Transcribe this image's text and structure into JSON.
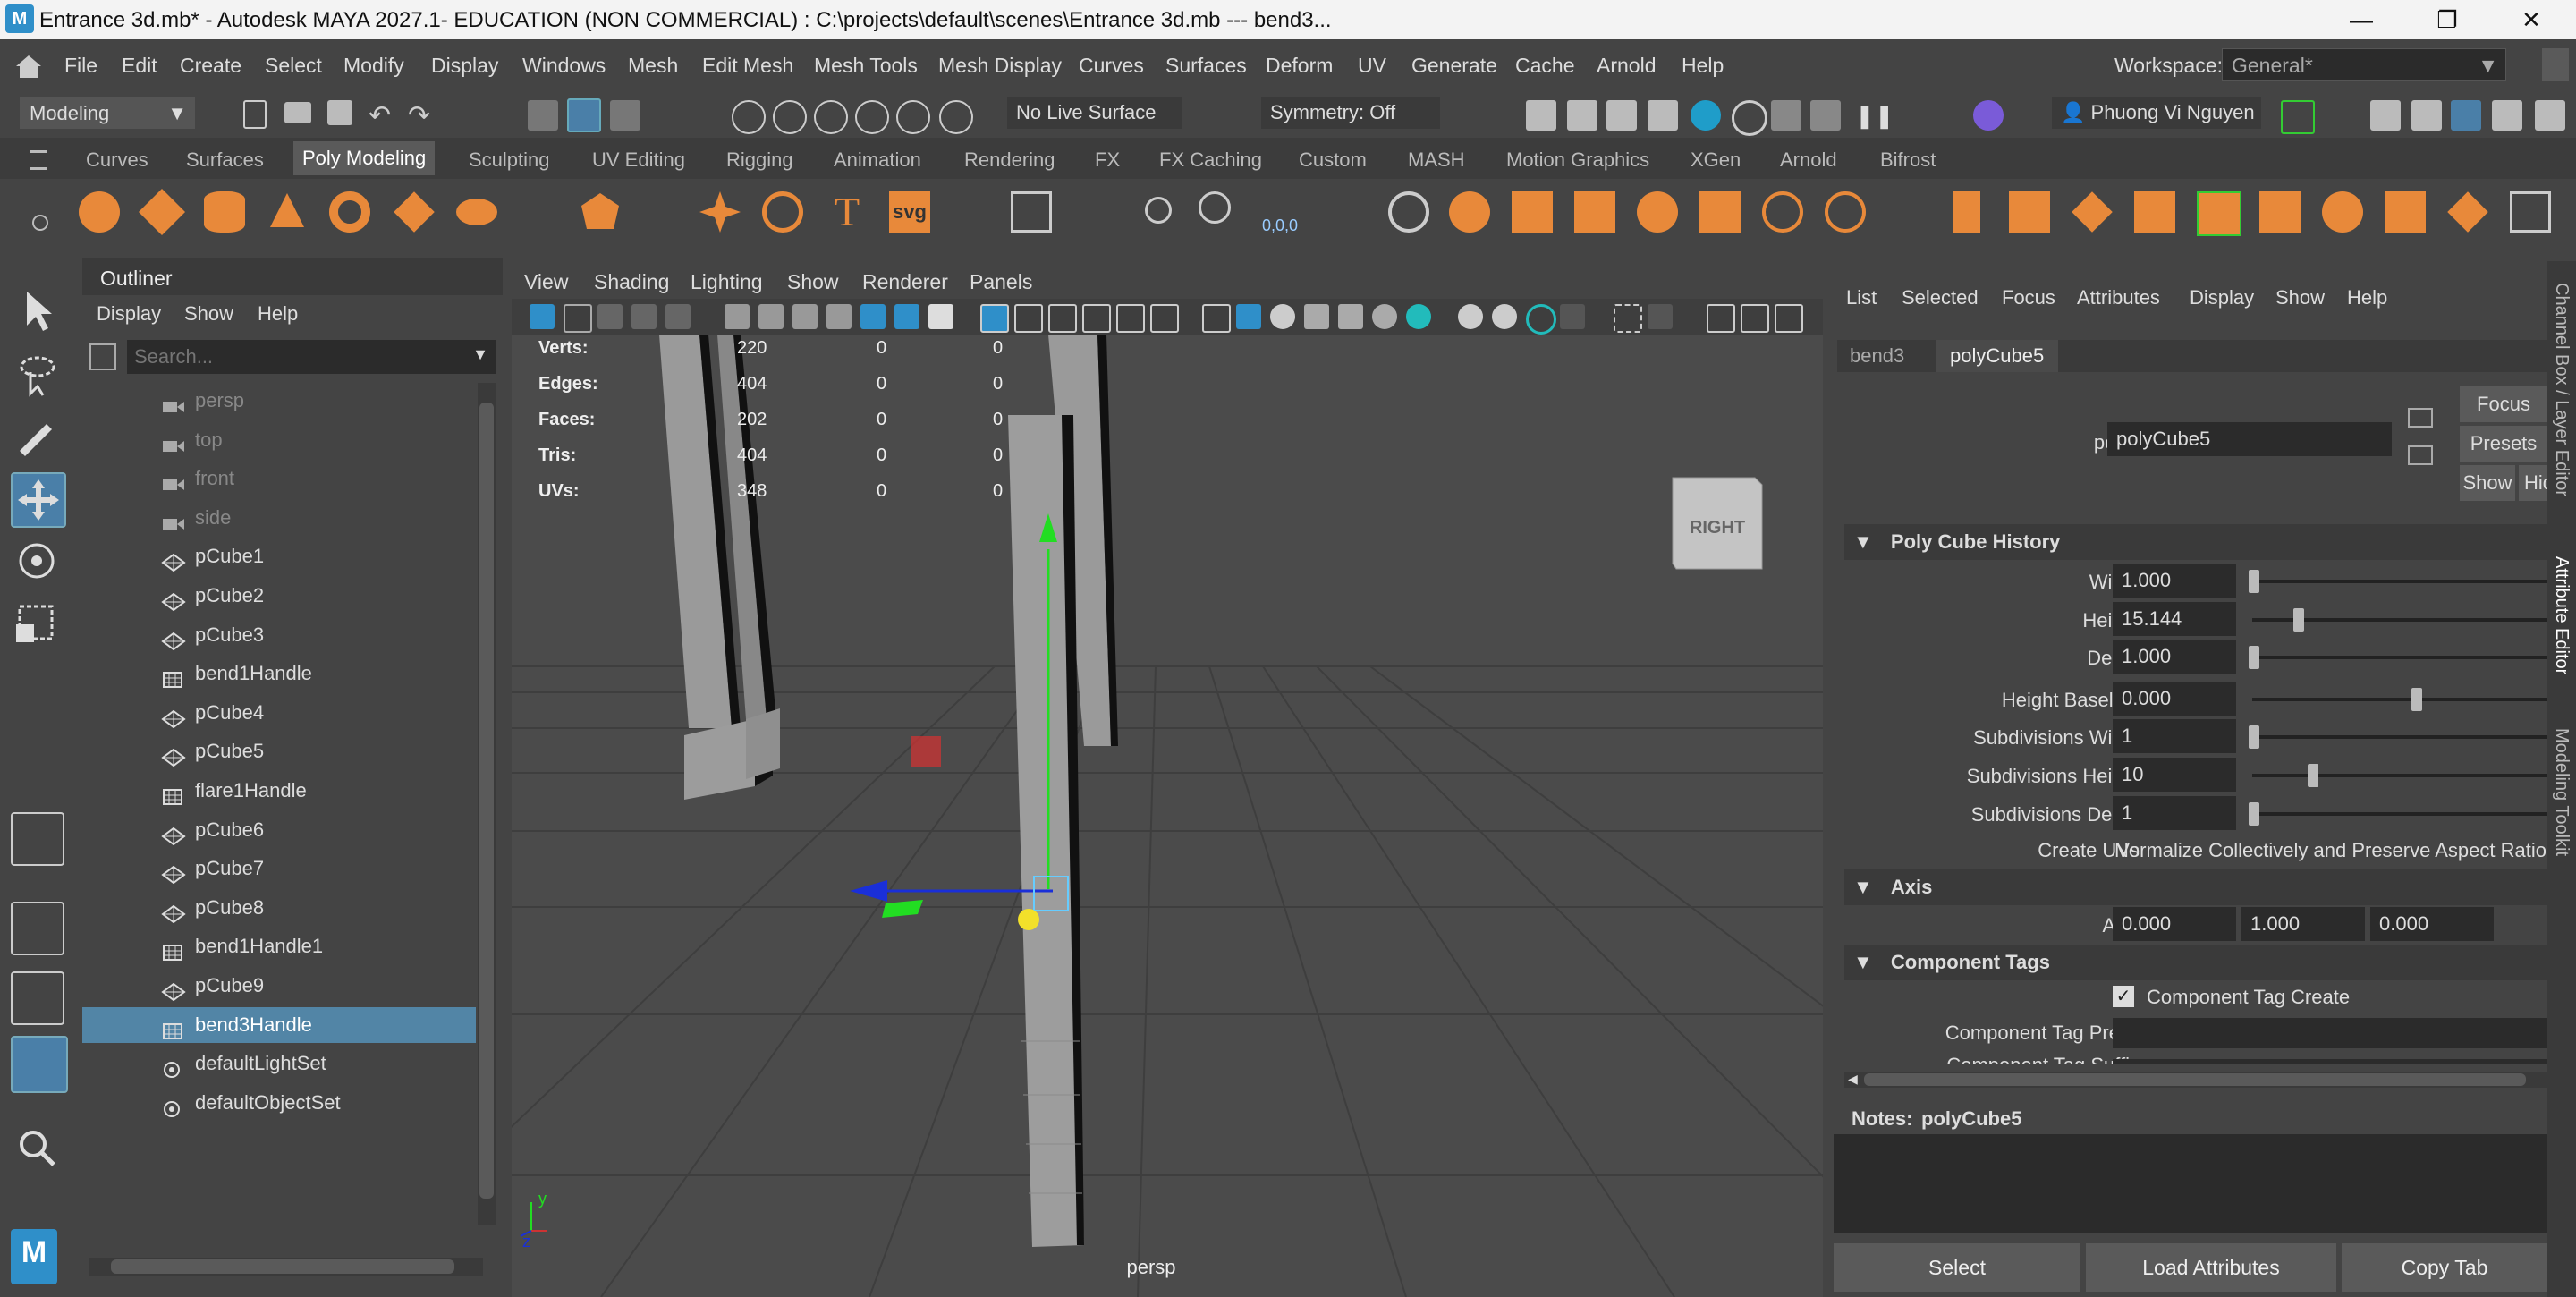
{
  "window": {
    "app_icon": "M",
    "title": "Entrance 3d.mb* - Autodesk MAYA 2027.1- EDUCATION (NON COMMERCIAL) : C:\\projects\\default\\scenes\\Entrance 3d.mb   ---   bend3...",
    "controls": [
      "minimize-icon",
      "restore-icon",
      "close-icon"
    ]
  },
  "menubar": {
    "items": [
      "File",
      "Edit",
      "Create",
      "Select",
      "Modify",
      "Display",
      "Windows",
      "Mesh",
      "Edit Mesh",
      "Mesh Tools",
      "Mesh Display",
      "Curves",
      "Surfaces",
      "Deform",
      "UV",
      "Generate",
      "Cache",
      "Arnold",
      "Help"
    ],
    "workspace_label": "Workspace:",
    "workspace_value": "General*"
  },
  "statusline": {
    "menuset": "Modeling",
    "live_surface": "No Live Surface",
    "symmetry": "Symmetry: Off",
    "user": "Phuong Vi Nguyen"
  },
  "shelf": {
    "tabs": [
      "Curves",
      "Surfaces",
      "Poly Modeling",
      "Sculpting",
      "UV Editing",
      "Rigging",
      "Animation",
      "Rendering",
      "FX",
      "FX Caching",
      "Custom",
      "MASH",
      "Motion Graphics",
      "XGen",
      "Arnold",
      "Bifrost"
    ],
    "active_tab": "Poly Modeling",
    "svg_label": "svg",
    "type_label": "T",
    "snow_label": "0,0,0"
  },
  "outliner": {
    "title": "Outliner",
    "menu": [
      "Display",
      "Show",
      "Help"
    ],
    "search_placeholder": "Search...",
    "items": [
      {
        "name": "persp",
        "icon": "camera-icon",
        "dim": true
      },
      {
        "name": "top",
        "icon": "camera-icon",
        "dim": true
      },
      {
        "name": "front",
        "icon": "camera-icon",
        "dim": true
      },
      {
        "name": "side",
        "icon": "camera-icon",
        "dim": true
      },
      {
        "name": "pCube1",
        "icon": "mesh-icon"
      },
      {
        "name": "pCube2",
        "icon": "mesh-icon"
      },
      {
        "name": "pCube3",
        "icon": "mesh-icon"
      },
      {
        "name": "bend1Handle",
        "icon": "deformer-handle-icon"
      },
      {
        "name": "pCube4",
        "icon": "mesh-icon"
      },
      {
        "name": "pCube5",
        "icon": "mesh-icon"
      },
      {
        "name": "flare1Handle",
        "icon": "deformer-handle-icon"
      },
      {
        "name": "pCube6",
        "icon": "mesh-icon"
      },
      {
        "name": "pCube7",
        "icon": "mesh-icon"
      },
      {
        "name": "pCube8",
        "icon": "mesh-icon"
      },
      {
        "name": "bend1Handle1",
        "icon": "deformer-handle-icon"
      },
      {
        "name": "pCube9",
        "icon": "mesh-icon"
      },
      {
        "name": "bend3Handle",
        "icon": "deformer-handle-icon",
        "selected": true
      },
      {
        "name": "defaultLightSet",
        "icon": "set-icon"
      },
      {
        "name": "defaultObjectSet",
        "icon": "set-icon"
      }
    ]
  },
  "viewport": {
    "menu": [
      "View",
      "Shading",
      "Lighting",
      "Show",
      "Renderer",
      "Panels"
    ],
    "hud": [
      {
        "label": "Verts:",
        "v1": "220",
        "v2": "0",
        "v3": "0"
      },
      {
        "label": "Edges:",
        "v1": "404",
        "v2": "0",
        "v3": "0"
      },
      {
        "label": "Faces:",
        "v1": "202",
        "v2": "0",
        "v3": "0"
      },
      {
        "label": "Tris:",
        "v1": "404",
        "v2": "0",
        "v3": "0"
      },
      {
        "label": "UVs:",
        "v1": "348",
        "v2": "0",
        "v3": "0"
      }
    ],
    "viewcube_label": "RIGHT",
    "camera_label": "persp",
    "axis_y": "y",
    "axis_z": "z"
  },
  "attribute_editor": {
    "menu": [
      "List",
      "Selected",
      "Focus",
      "Attributes",
      "Display",
      "Show",
      "Help"
    ],
    "tabs": [
      "bend3",
      "polyCube5"
    ],
    "active_tab": "polyCube5",
    "node_label": "polyCube:",
    "node_value": "polyCube5",
    "buttons": {
      "focus": "Focus",
      "presets": "Presets",
      "show": "Show",
      "hide": "Hide"
    },
    "sections": {
      "poly_cube_history": "Poly Cube History",
      "axis": "Axis",
      "component_tags": "Component Tags"
    },
    "attrs": [
      {
        "label": "Width",
        "value": "1.000",
        "slider": 0.0
      },
      {
        "label": "Height",
        "value": "15.144",
        "slider": 0.15
      },
      {
        "label": "Depth",
        "value": "1.000",
        "slider": 0.0
      },
      {
        "label": "Height Baseline",
        "value": "0.000",
        "slider": 0.55
      },
      {
        "label": "Subdivisions Width",
        "value": "1",
        "slider": 0.0
      },
      {
        "label": "Subdivisions Height",
        "value": "10",
        "slider": 0.2
      },
      {
        "label": "Subdivisions Depth",
        "value": "1",
        "slider": 0.0
      }
    ],
    "create_uvs_label": "Create UVs",
    "create_uvs_value": "Normalize Collectively and Preserve Aspect Ratio",
    "axis_label": "Axis",
    "axis_values": [
      "0.000",
      "1.000",
      "0.000"
    ],
    "component_tag_create": "Component Tag Create",
    "component_tag_create_checked": true,
    "component_tag_prefix_label": "Component Tag Prefix",
    "component_tag_suffix_label": "Component Tag Suffix",
    "notes_label": "Notes:",
    "notes_node": "polyCube5",
    "bottom_buttons": [
      "Select",
      "Load Attributes",
      "Copy Tab"
    ]
  },
  "side_tabs": [
    "Channel Box / Layer Editor",
    "Attribute Editor",
    "Modeling Toolkit"
  ],
  "colors": {
    "accent_orange": "#e8893a",
    "selection_blue": "#5285a6",
    "active_tool_blue": "#4a7fa8",
    "manip_green": "#22dd22",
    "manip_blue": "#1a2fd8",
    "manip_red": "#cc3333",
    "manip_yellow": "#f2e02a"
  }
}
